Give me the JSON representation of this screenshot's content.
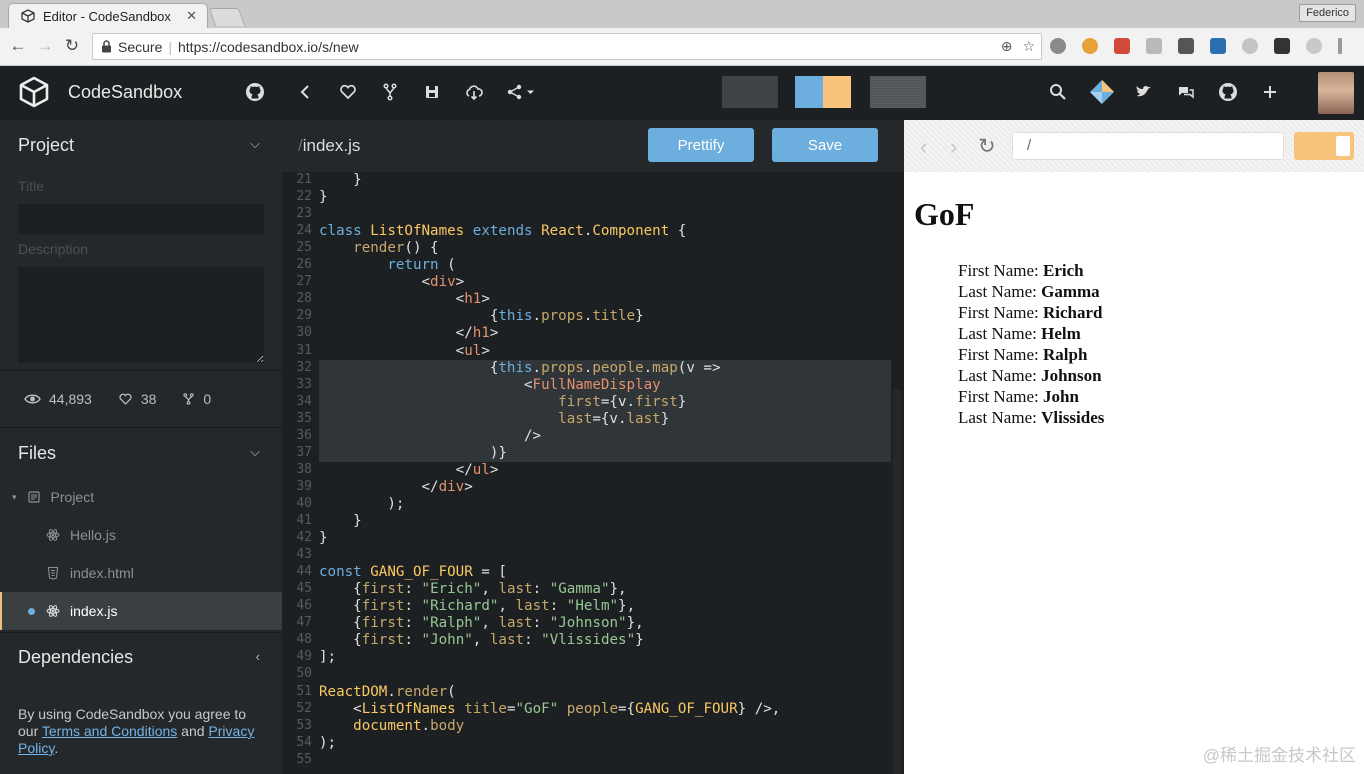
{
  "browser": {
    "tab_title": "Editor - CodeSandbox",
    "user": "Federico",
    "secure_label": "Secure",
    "url": "https://codesandbox.io/s/new"
  },
  "app": {
    "brand": "CodeSandbox",
    "swatch_colors": [
      "#3e4345",
      "#6caedd",
      "#f8c37b",
      "#4e5355"
    ]
  },
  "sidebar": {
    "project_label": "Project",
    "title_label": "Title",
    "description_label": "Description",
    "views": "44,893",
    "likes": "38",
    "forks": "0",
    "files_label": "Files",
    "files": [
      {
        "name": "Project",
        "icon": "folder-icon"
      },
      {
        "name": "Hello.js",
        "icon": "react-icon"
      },
      {
        "name": "index.html",
        "icon": "html-icon"
      },
      {
        "name": "index.js",
        "icon": "react-icon",
        "active": true
      }
    ],
    "dependencies_label": "Dependencies",
    "legal_prefix": "By using CodeSandbox you agree to our ",
    "terms_link": "Terms and Conditions",
    "legal_and": " and ",
    "privacy_link": "Privacy Policy",
    "legal_suffix": "."
  },
  "editor": {
    "slash": "/",
    "file_name": "index.js",
    "prettify_label": "Prettify",
    "save_label": "Save",
    "highlight_from": 32,
    "highlight_to": 37,
    "lines": [
      {
        "n": 21,
        "code": "    }"
      },
      {
        "n": 22,
        "code": "}"
      },
      {
        "n": 23,
        "code": ""
      },
      {
        "n": 24,
        "code": "class ListOfNames extends React.Component {"
      },
      {
        "n": 25,
        "code": "    render() {"
      },
      {
        "n": 26,
        "code": "        return ("
      },
      {
        "n": 27,
        "code": "            <div>"
      },
      {
        "n": 28,
        "code": "                <h1>"
      },
      {
        "n": 29,
        "code": "                    {this.props.title}"
      },
      {
        "n": 30,
        "code": "                </h1>"
      },
      {
        "n": 31,
        "code": "                <ul>"
      },
      {
        "n": 32,
        "code": "                    {this.props.people.map(v =>"
      },
      {
        "n": 33,
        "code": "                        <FullNameDisplay"
      },
      {
        "n": 34,
        "code": "                            first={v.first}"
      },
      {
        "n": 35,
        "code": "                            last={v.last}"
      },
      {
        "n": 36,
        "code": "                        />"
      },
      {
        "n": 37,
        "code": "                    )}"
      },
      {
        "n": 38,
        "code": "                </ul>"
      },
      {
        "n": 39,
        "code": "            </div>"
      },
      {
        "n": 40,
        "code": "        );"
      },
      {
        "n": 41,
        "code": "    }"
      },
      {
        "n": 42,
        "code": "}"
      },
      {
        "n": 43,
        "code": ""
      },
      {
        "n": 44,
        "code": "const GANG_OF_FOUR = ["
      },
      {
        "n": 45,
        "code": "    {first: \"Erich\", last: \"Gamma\"},"
      },
      {
        "n": 46,
        "code": "    {first: \"Richard\", last: \"Helm\"},"
      },
      {
        "n": 47,
        "code": "    {first: \"Ralph\", last: \"Johnson\"},"
      },
      {
        "n": 48,
        "code": "    {first: \"John\", last: \"Vlissides\"}"
      },
      {
        "n": 49,
        "code": "];"
      },
      {
        "n": 50,
        "code": ""
      },
      {
        "n": 51,
        "code": "ReactDOM.render("
      },
      {
        "n": 52,
        "code": "    <ListOfNames title=\"GoF\" people={GANG_OF_FOUR} />,"
      },
      {
        "n": 53,
        "code": "    document.body"
      },
      {
        "n": 54,
        "code": ");"
      },
      {
        "n": 55,
        "code": ""
      }
    ]
  },
  "preview": {
    "address": "/",
    "title": "GoF",
    "items": [
      {
        "label": "First Name: ",
        "value": "Erich"
      },
      {
        "label": "Last Name: ",
        "value": "Gamma"
      },
      {
        "label": "First Name: ",
        "value": "Richard"
      },
      {
        "label": "Last Name: ",
        "value": "Helm"
      },
      {
        "label": "First Name: ",
        "value": "Ralph"
      },
      {
        "label": "Last Name: ",
        "value": "Johnson"
      },
      {
        "label": "First Name: ",
        "value": "John"
      },
      {
        "label": "Last Name: ",
        "value": "Vlissides"
      }
    ]
  },
  "watermark": "@稀土掘金技术社区"
}
